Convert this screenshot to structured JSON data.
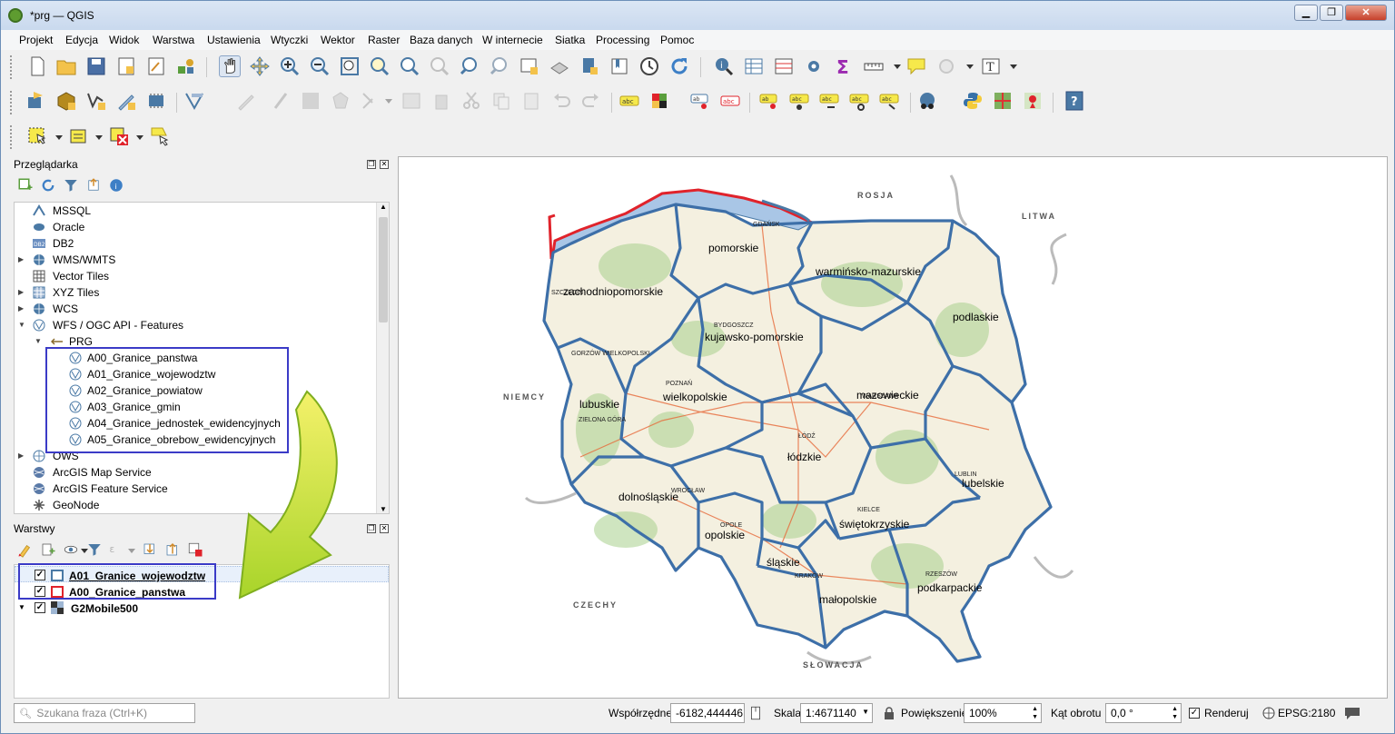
{
  "window": {
    "title": "*prg — QGIS",
    "minimize": "▁",
    "restore": "❐",
    "close": "✕"
  },
  "menu": [
    "Projekt",
    "Edycja",
    "Widok",
    "Warstwa",
    "Ustawienia",
    "Wtyczki",
    "Wektor",
    "Raster",
    "Baza danych",
    "W internecie",
    "Siatka",
    "Processing",
    "Pomoc"
  ],
  "browser": {
    "title": "Przeglądarka",
    "items": [
      {
        "label": "MSSQL",
        "icon": "mssql-icon"
      },
      {
        "label": "Oracle",
        "icon": "oracle-icon"
      },
      {
        "label": "DB2",
        "icon": "db2-icon"
      },
      {
        "label": "WMS/WMTS",
        "icon": "wms-icon",
        "expander": "▶"
      },
      {
        "label": "Vector Tiles",
        "icon": "vector-tiles-icon"
      },
      {
        "label": "XYZ Tiles",
        "icon": "xyz-tiles-icon",
        "expander": "▶"
      },
      {
        "label": "WCS",
        "icon": "wcs-icon",
        "expander": "▶"
      },
      {
        "label": "WFS / OGC API - Features",
        "icon": "wfs-icon",
        "expander": "▼"
      },
      {
        "label": "PRG",
        "icon": "connection-icon",
        "expander": "▼"
      },
      {
        "label": "A00_Granice_panstwa",
        "icon": "wfs-layer-icon"
      },
      {
        "label": "A01_Granice_wojewodztw",
        "icon": "wfs-layer-icon"
      },
      {
        "label": "A02_Granice_powiatow",
        "icon": "wfs-layer-icon"
      },
      {
        "label": "A03_Granice_gmin",
        "icon": "wfs-layer-icon"
      },
      {
        "label": "A04_Granice_jednostek_ewidencyjnych",
        "icon": "wfs-layer-icon"
      },
      {
        "label": "A05_Granice_obrebow_ewidencyjnych",
        "icon": "wfs-layer-icon"
      },
      {
        "label": "OWS",
        "icon": "ows-icon",
        "expander": "▶"
      },
      {
        "label": "ArcGIS Map Service",
        "icon": "arcgis-icon"
      },
      {
        "label": "ArcGIS Feature Service",
        "icon": "arcgis-icon"
      },
      {
        "label": "GeoNode",
        "icon": "geonode-icon"
      }
    ]
  },
  "layers_panel": {
    "title": "Warstwy",
    "layers": [
      {
        "label": "A01_Granice_wojewodztw",
        "checked": "✓",
        "symbol_color": "#4a79a5"
      },
      {
        "label": "A00_Granice_panstwa",
        "checked": "✓",
        "symbol_color": "#e0232b"
      },
      {
        "label": "G2Mobile500",
        "checked": "✓",
        "expander": "▼"
      }
    ]
  },
  "map": {
    "voivodeships": [
      "pomorskie",
      "warmińsko-mazurskie",
      "zachodniopomorskie",
      "podlaskie",
      "kujawsko-pomorskie",
      "wielkopolskie",
      "mazowieckie",
      "lubuskie",
      "łódzkie",
      "lubelskie",
      "dolnośląskie",
      "świętokrzyskie",
      "opolskie",
      "śląskie",
      "podkarpackie",
      "małopolskie"
    ],
    "countries": [
      "ROSJA",
      "LITWA",
      "NIEMCY",
      "CZECHY",
      "SŁOWACJA"
    ],
    "cities": [
      "GDAŃSK",
      "BYDGOSZCZ",
      "POZNAŃ",
      "GORZÓW WIELKOPOLSKI",
      "ZIELONA GÓRA",
      "ŁÓDŹ",
      "WROCŁAW",
      "OPOLE",
      "KIELCE",
      "LUBLIN",
      "KRAKÓW",
      "RZESZÓW",
      "WARSZAWA",
      "SZCZECIN"
    ]
  },
  "statusbar": {
    "search_placeholder": "Szukana fraza (Ctrl+K)",
    "coord_label": "Współrzędne",
    "coord_value": "-6182,444446",
    "scale_label": "Skala",
    "scale_value": "1:4671140",
    "zoom_label": "Powiększenie",
    "zoom_value": "100%",
    "rotation_label": "Kąt obrotu",
    "rotation_value": "0,0 °",
    "render_label": "Renderuj",
    "crs": "EPSG:2180"
  },
  "colors": {
    "accent_blue": "#3b3bc7",
    "state_border_red": "#e0232b",
    "voivodeship_border": "#3d6fa8",
    "arrow_green": "#8cc63f"
  }
}
